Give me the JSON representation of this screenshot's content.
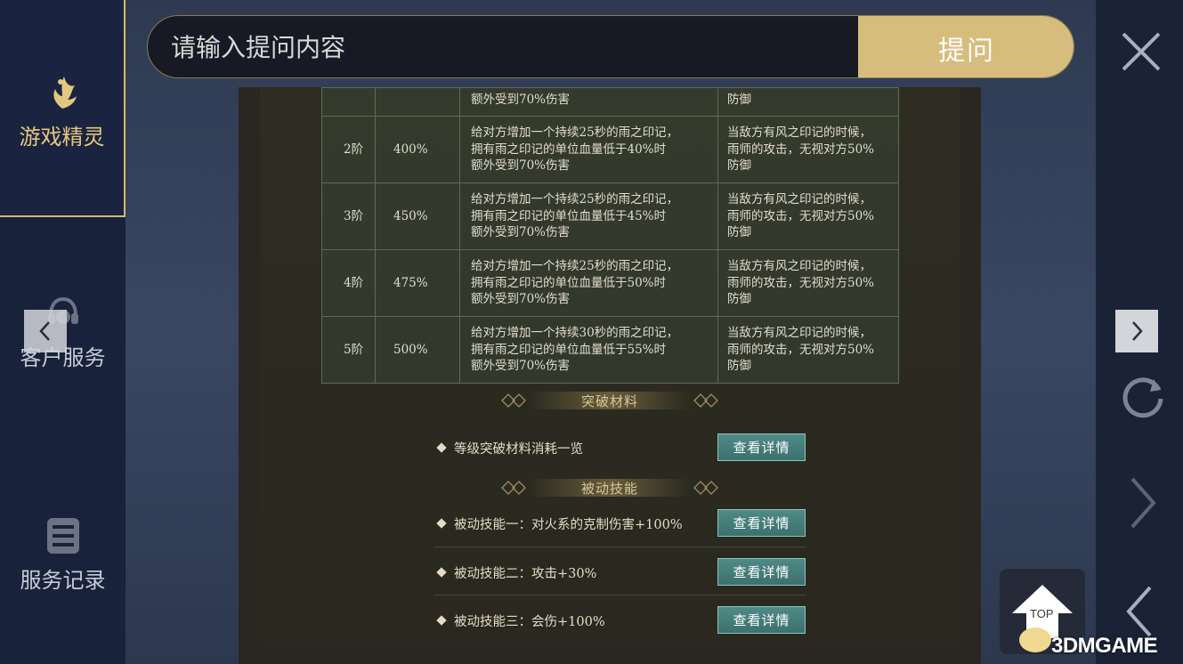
{
  "sidebar": {
    "items": [
      {
        "label": "游戏精灵",
        "icon": "fairy-icon",
        "active": true
      },
      {
        "label": "客户服务",
        "icon": "headset-icon",
        "active": false
      },
      {
        "label": "服务记录",
        "icon": "list-icon",
        "active": false
      }
    ]
  },
  "search": {
    "placeholder": "请输入提问内容",
    "button_label": "提问"
  },
  "table": {
    "partial_row": {
      "effect_line": "额外受到70%伤害",
      "bonus_line": "防御"
    },
    "rows": [
      {
        "level": "2阶",
        "percent": "400%",
        "effect": [
          "给对方增加一个持续25秒的雨之印记，",
          "拥有雨之印记的单位血量低于40%时",
          "额外受到70%伤害"
        ],
        "bonus": [
          "当敌方有风之印记的时候，",
          "雨师的攻击，无视对方50%",
          "防御"
        ]
      },
      {
        "level": "3阶",
        "percent": "450%",
        "effect": [
          "给对方增加一个持续25秒的雨之印记，",
          "拥有雨之印记的单位血量低于45%时",
          "额外受到70%伤害"
        ],
        "bonus": [
          "当敌方有风之印记的时候，",
          "雨师的攻击，无视对方50%",
          "防御"
        ]
      },
      {
        "level": "4阶",
        "percent": "475%",
        "effect": [
          "给对方增加一个持续25秒的雨之印记，",
          "拥有雨之印记的单位血量低于50%时",
          "额外受到70%伤害"
        ],
        "bonus": [
          "当敌方有风之印记的时候，",
          "雨师的攻击，无视对方50%",
          "防御"
        ]
      },
      {
        "level": "5阶",
        "percent": "500%",
        "effect": [
          "给对方增加一个持续30秒的雨之印记，",
          "拥有雨之印记的单位血量低于55%时",
          "额外受到70%伤害"
        ],
        "bonus": [
          "当敌方有风之印记的时候，",
          "雨师的攻击，无视对方50%",
          "防御"
        ]
      }
    ]
  },
  "sections": {
    "breakthrough": {
      "title": "突破材料",
      "items": [
        {
          "label": "等级突破材料消耗一览",
          "button": "查看详情"
        }
      ]
    },
    "passive": {
      "title": "被动技能",
      "items": [
        {
          "label": "被动技能一：对火系的克制伤害+100%",
          "button": "查看详情"
        },
        {
          "label": "被动技能二：攻击+30%",
          "button": "查看详情"
        },
        {
          "label": "被动技能三：会伤+100%",
          "button": "查看详情"
        }
      ]
    }
  },
  "overlay": {
    "top_label": "TOP",
    "watermark": "3DMGAME"
  },
  "colors": {
    "accent_gold": "#d7bd7d",
    "detail_button": "#4f8a86",
    "sidebar_bg": "#18223a"
  }
}
